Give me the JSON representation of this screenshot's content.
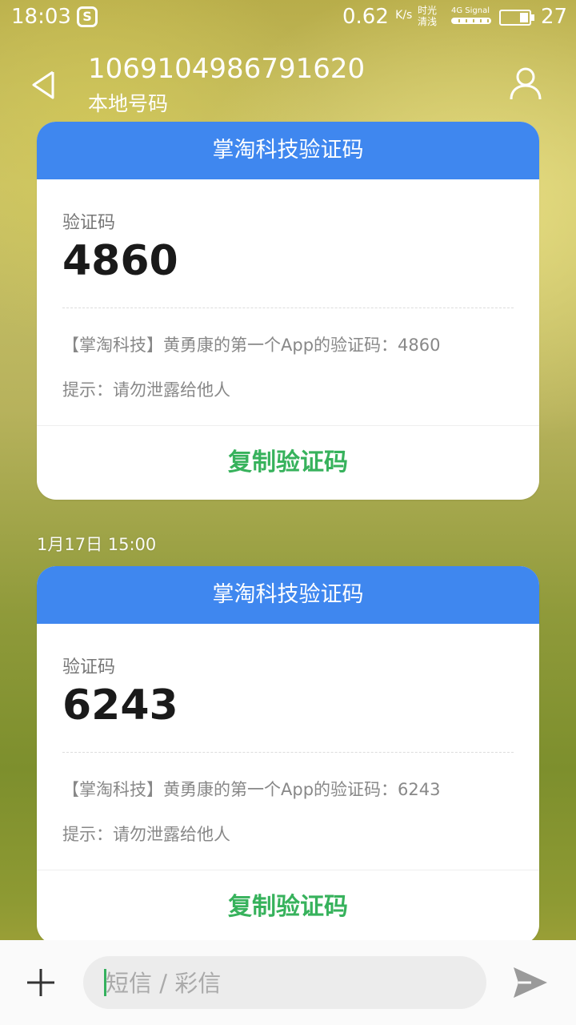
{
  "status_bar": {
    "time": "18:03",
    "app_badge": "S",
    "speed": "0.62",
    "speed_unit": "K/s",
    "carrier_top": "时光",
    "carrier_bottom": "清浅",
    "signal_label": "4G Signal",
    "battery": "27"
  },
  "header": {
    "number": "1069104986791620",
    "subtitle": "本地号码"
  },
  "messages": [
    {
      "title": "掌淘科技验证码",
      "code_label": "验证码",
      "code": "4860",
      "body": "【掌淘科技】黄勇康的第一个App的验证码：4860",
      "hint": "提示：请勿泄露给他人",
      "copy_label": "复制验证码"
    },
    {
      "date": "1月17日 15:00",
      "title": "掌淘科技验证码",
      "code_label": "验证码",
      "code": "6243",
      "body": "【掌淘科技】黄勇康的第一个App的验证码：6243",
      "hint": "提示：请勿泄露给他人",
      "copy_label": "复制验证码"
    }
  ],
  "composer": {
    "placeholder": "短信 / 彩信"
  },
  "icons": {
    "back": "back-icon",
    "contact": "contact-icon",
    "add": "plus-icon",
    "send": "send-icon"
  },
  "colors": {
    "card_header": "#3f87ef",
    "copy_button": "#37b25c",
    "caret": "#35b15e"
  }
}
